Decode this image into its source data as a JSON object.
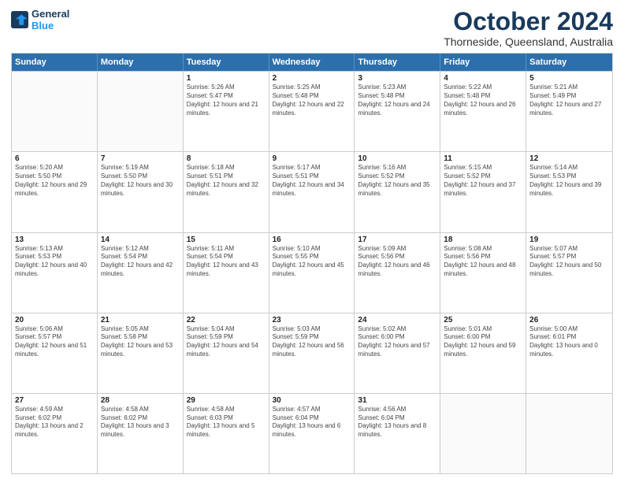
{
  "header": {
    "logo_line1": "General",
    "logo_line2": "Blue",
    "month": "October 2024",
    "location": "Thorneside, Queensland, Australia"
  },
  "days_of_week": [
    "Sunday",
    "Monday",
    "Tuesday",
    "Wednesday",
    "Thursday",
    "Friday",
    "Saturday"
  ],
  "weeks": [
    [
      {
        "day": "",
        "sunrise": "",
        "sunset": "",
        "daylight": ""
      },
      {
        "day": "",
        "sunrise": "",
        "sunset": "",
        "daylight": ""
      },
      {
        "day": "1",
        "sunrise": "Sunrise: 5:26 AM",
        "sunset": "Sunset: 5:47 PM",
        "daylight": "Daylight: 12 hours and 21 minutes."
      },
      {
        "day": "2",
        "sunrise": "Sunrise: 5:25 AM",
        "sunset": "Sunset: 5:48 PM",
        "daylight": "Daylight: 12 hours and 22 minutes."
      },
      {
        "day": "3",
        "sunrise": "Sunrise: 5:23 AM",
        "sunset": "Sunset: 5:48 PM",
        "daylight": "Daylight: 12 hours and 24 minutes."
      },
      {
        "day": "4",
        "sunrise": "Sunrise: 5:22 AM",
        "sunset": "Sunset: 5:48 PM",
        "daylight": "Daylight: 12 hours and 26 minutes."
      },
      {
        "day": "5",
        "sunrise": "Sunrise: 5:21 AM",
        "sunset": "Sunset: 5:49 PM",
        "daylight": "Daylight: 12 hours and 27 minutes."
      }
    ],
    [
      {
        "day": "6",
        "sunrise": "Sunrise: 5:20 AM",
        "sunset": "Sunset: 5:50 PM",
        "daylight": "Daylight: 12 hours and 29 minutes."
      },
      {
        "day": "7",
        "sunrise": "Sunrise: 5:19 AM",
        "sunset": "Sunset: 5:50 PM",
        "daylight": "Daylight: 12 hours and 30 minutes."
      },
      {
        "day": "8",
        "sunrise": "Sunrise: 5:18 AM",
        "sunset": "Sunset: 5:51 PM",
        "daylight": "Daylight: 12 hours and 32 minutes."
      },
      {
        "day": "9",
        "sunrise": "Sunrise: 5:17 AM",
        "sunset": "Sunset: 5:51 PM",
        "daylight": "Daylight: 12 hours and 34 minutes."
      },
      {
        "day": "10",
        "sunrise": "Sunrise: 5:16 AM",
        "sunset": "Sunset: 5:52 PM",
        "daylight": "Daylight: 12 hours and 35 minutes."
      },
      {
        "day": "11",
        "sunrise": "Sunrise: 5:15 AM",
        "sunset": "Sunset: 5:52 PM",
        "daylight": "Daylight: 12 hours and 37 minutes."
      },
      {
        "day": "12",
        "sunrise": "Sunrise: 5:14 AM",
        "sunset": "Sunset: 5:53 PM",
        "daylight": "Daylight: 12 hours and 39 minutes."
      }
    ],
    [
      {
        "day": "13",
        "sunrise": "Sunrise: 5:13 AM",
        "sunset": "Sunset: 5:53 PM",
        "daylight": "Daylight: 12 hours and 40 minutes."
      },
      {
        "day": "14",
        "sunrise": "Sunrise: 5:12 AM",
        "sunset": "Sunset: 5:54 PM",
        "daylight": "Daylight: 12 hours and 42 minutes."
      },
      {
        "day": "15",
        "sunrise": "Sunrise: 5:11 AM",
        "sunset": "Sunset: 5:54 PM",
        "daylight": "Daylight: 12 hours and 43 minutes."
      },
      {
        "day": "16",
        "sunrise": "Sunrise: 5:10 AM",
        "sunset": "Sunset: 5:55 PM",
        "daylight": "Daylight: 12 hours and 45 minutes."
      },
      {
        "day": "17",
        "sunrise": "Sunrise: 5:09 AM",
        "sunset": "Sunset: 5:56 PM",
        "daylight": "Daylight: 12 hours and 46 minutes."
      },
      {
        "day": "18",
        "sunrise": "Sunrise: 5:08 AM",
        "sunset": "Sunset: 5:56 PM",
        "daylight": "Daylight: 12 hours and 48 minutes."
      },
      {
        "day": "19",
        "sunrise": "Sunrise: 5:07 AM",
        "sunset": "Sunset: 5:57 PM",
        "daylight": "Daylight: 12 hours and 50 minutes."
      }
    ],
    [
      {
        "day": "20",
        "sunrise": "Sunrise: 5:06 AM",
        "sunset": "Sunset: 5:57 PM",
        "daylight": "Daylight: 12 hours and 51 minutes."
      },
      {
        "day": "21",
        "sunrise": "Sunrise: 5:05 AM",
        "sunset": "Sunset: 5:58 PM",
        "daylight": "Daylight: 12 hours and 53 minutes."
      },
      {
        "day": "22",
        "sunrise": "Sunrise: 5:04 AM",
        "sunset": "Sunset: 5:59 PM",
        "daylight": "Daylight: 12 hours and 54 minutes."
      },
      {
        "day": "23",
        "sunrise": "Sunrise: 5:03 AM",
        "sunset": "Sunset: 5:59 PM",
        "daylight": "Daylight: 12 hours and 56 minutes."
      },
      {
        "day": "24",
        "sunrise": "Sunrise: 5:02 AM",
        "sunset": "Sunset: 6:00 PM",
        "daylight": "Daylight: 12 hours and 57 minutes."
      },
      {
        "day": "25",
        "sunrise": "Sunrise: 5:01 AM",
        "sunset": "Sunset: 6:00 PM",
        "daylight": "Daylight: 12 hours and 59 minutes."
      },
      {
        "day": "26",
        "sunrise": "Sunrise: 5:00 AM",
        "sunset": "Sunset: 6:01 PM",
        "daylight": "Daylight: 13 hours and 0 minutes."
      }
    ],
    [
      {
        "day": "27",
        "sunrise": "Sunrise: 4:59 AM",
        "sunset": "Sunset: 6:02 PM",
        "daylight": "Daylight: 13 hours and 2 minutes."
      },
      {
        "day": "28",
        "sunrise": "Sunrise: 4:58 AM",
        "sunset": "Sunset: 6:02 PM",
        "daylight": "Daylight: 13 hours and 3 minutes."
      },
      {
        "day": "29",
        "sunrise": "Sunrise: 4:58 AM",
        "sunset": "Sunset: 6:03 PM",
        "daylight": "Daylight: 13 hours and 5 minutes."
      },
      {
        "day": "30",
        "sunrise": "Sunrise: 4:57 AM",
        "sunset": "Sunset: 6:04 PM",
        "daylight": "Daylight: 13 hours and 6 minutes."
      },
      {
        "day": "31",
        "sunrise": "Sunrise: 4:56 AM",
        "sunset": "Sunset: 6:04 PM",
        "daylight": "Daylight: 13 hours and 8 minutes."
      },
      {
        "day": "",
        "sunrise": "",
        "sunset": "",
        "daylight": ""
      },
      {
        "day": "",
        "sunrise": "",
        "sunset": "",
        "daylight": ""
      }
    ]
  ]
}
